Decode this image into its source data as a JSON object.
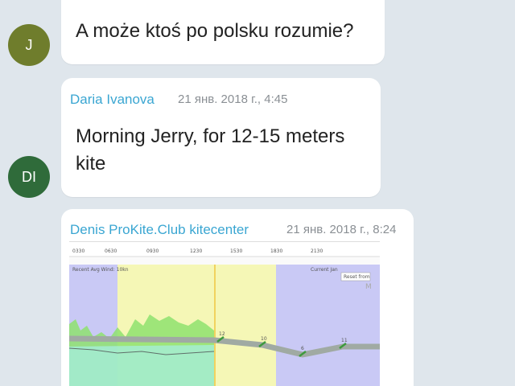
{
  "messages": [
    {
      "text": "A może ktoś po polsku rozumie?",
      "avatar_initials": "J",
      "avatar_color": "#6f7d2c"
    },
    {
      "sender": "Daria Ivanova",
      "time": "21 янв. 2018 г., 4:45",
      "text_line1": "Morning Jerry, for 12-15 meters",
      "text_line2": "kite",
      "avatar_initials": "DI",
      "avatar_color": "#2f6b3a"
    },
    {
      "sender": "Denis ProKite.Club kitecenter",
      "time": "21 янв. 2018 г., 8:24",
      "attachment": {
        "panel_label": "Recent Avg Wind: 10kn",
        "reset_button": "Reset from",
        "top_right_label": "Current Jan",
        "tick_labels": [
          "0330",
          "0630",
          "0930",
          "1230",
          "1530",
          "1830",
          "2130"
        ],
        "wind_labels": [
          "12",
          "10",
          "6",
          "11"
        ],
        "colors": {
          "night": "#c9c9f5",
          "day": "#f5f7b6",
          "wind_line": "#a0aaa3",
          "wind_fill": "#8ee26e"
        }
      }
    }
  ],
  "colors": {
    "background": "#dfe6ec",
    "bubble": "#ffffff",
    "sender_name": "#3aa6d2",
    "timestamp": "#8a8f94"
  }
}
